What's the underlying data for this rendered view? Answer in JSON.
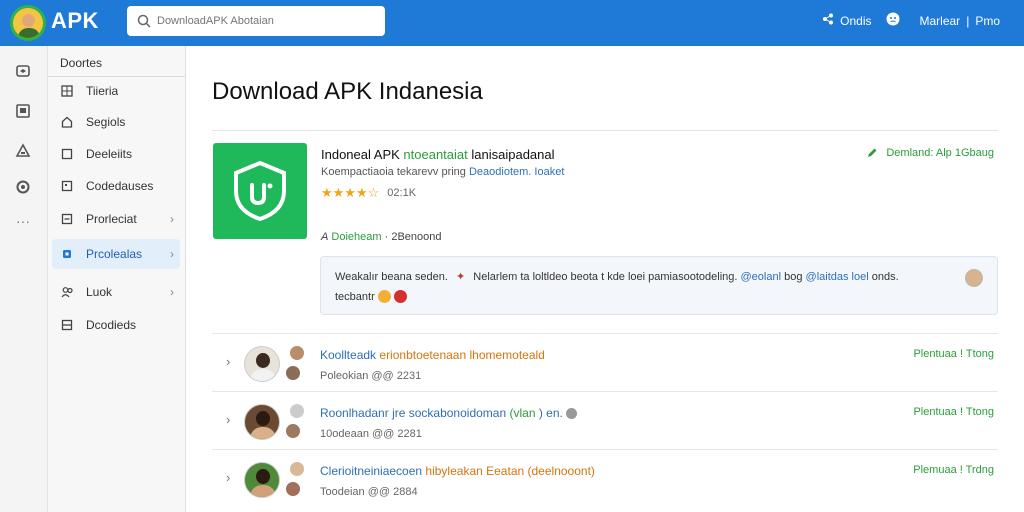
{
  "header": {
    "brand": "APK",
    "search_placeholder": "DownloadAPK Abotaian",
    "right_item_1": "Ondis",
    "right_item_2": "Marlear",
    "right_sep": "|",
    "right_item_3": "Pmo"
  },
  "sidebar": {
    "title": "Doortes",
    "items": [
      {
        "label": "Tiieria",
        "icon": "grid-icon"
      },
      {
        "label": "Segiols",
        "icon": "home-icon"
      },
      {
        "label": "Deeleiits",
        "icon": "document-icon"
      },
      {
        "label": "Codedauses",
        "icon": "code-icon"
      },
      {
        "label": "Prorleciat",
        "icon": "box-icon"
      },
      {
        "label": "Prcolealas",
        "icon": "lock-icon"
      },
      {
        "label": "Luok",
        "icon": "users-icon"
      },
      {
        "label": "Dcodieds",
        "icon": "list-icon"
      }
    ]
  },
  "main": {
    "title": "Download APK Indanesia",
    "app": {
      "name": "Indoneal APK",
      "name_green": "ntoeantaiat",
      "name_rest": "lanisaipadanal",
      "sub": "Koempactiaoia tekarevv pring",
      "sub_blue": "Deaodiotem.  Ioaket",
      "stars": "★★★★☆",
      "rating_count": "02:1K",
      "download_link": "Demland: Alp 1Gbaug",
      "meta_prefix": "A",
      "meta_green": "Doieheam",
      "meta_rest": "· 2Benoond"
    },
    "comment": {
      "line1_a": "Weakalır beana seden.",
      "line1_b": "Nelarlem  ta  loltldeo  beota t kde  loei  pamiasootodeling.",
      "line1_c": "@eolanl",
      "line1_d": "bog",
      "line1_e": "@laitdas  loel",
      "line1_f": "onds.",
      "line2": "tecbantr"
    },
    "rows": [
      {
        "title_a": "Koollteadk",
        "title_b": "erionbtoetenaan",
        "title_c": "lhomemoteald",
        "sub": "Poleokian  @@  2231",
        "status": "Plentuaa ! Ttong"
      },
      {
        "title_a": "Roonlhadanr",
        "title_b": "jre sockabonoidoman",
        "title_c": "(vlan",
        "title_d": ") en.",
        "sub": "10odeaan  @@  2281",
        "status": "Plentuaa ! Ttong"
      },
      {
        "title_a": "Clerioitneiniaecoen",
        "title_b": "hibyleakan Eeatan",
        "title_c": "(deelnooont)",
        "sub": "Toodeian  @@  2884",
        "status": "Plemuaa ! Trdng"
      }
    ]
  },
  "colors": {
    "topbar": "#1e7ad6",
    "accent_green": "#2a9d3a",
    "link_blue": "#2e6fb8",
    "star": "#f0a61c"
  }
}
